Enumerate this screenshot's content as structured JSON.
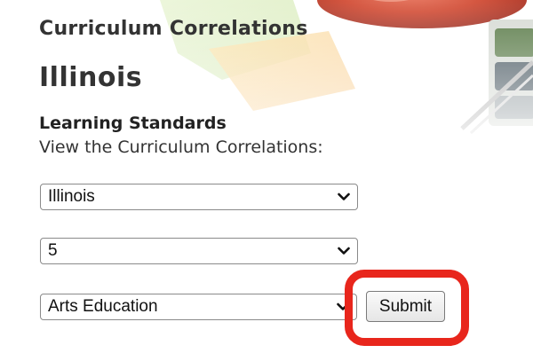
{
  "page": {
    "section_heading": "Curriculum Correlations",
    "state_title": "Illinois",
    "standards_heading": "Learning Standards",
    "instruction": "View the Curriculum Correlations:"
  },
  "form": {
    "state_select": {
      "selected": "Illinois"
    },
    "grade_select": {
      "selected": "5"
    },
    "subject_select": {
      "selected": "Arts Education"
    },
    "submit_label": "Submit"
  },
  "colors": {
    "highlight": "#e8261c",
    "text": "#333333"
  }
}
